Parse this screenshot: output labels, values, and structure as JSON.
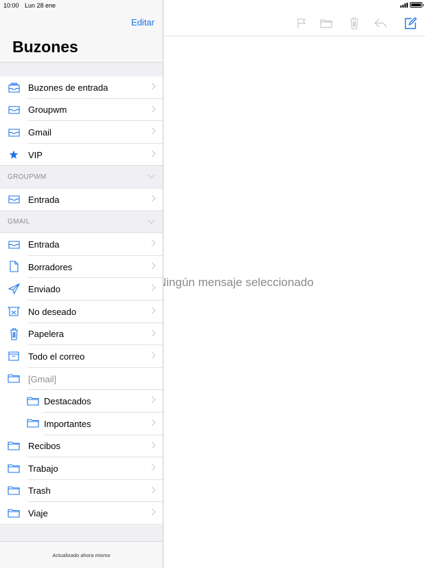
{
  "status_bar": {
    "time": "10:00",
    "date": "Lun 28 ene"
  },
  "sidebar": {
    "edit_label": "Editar",
    "title": "Buzones",
    "rows": [
      {
        "kind": "row",
        "label": "Buzones de entrada",
        "icon": "inbox-stack-icon",
        "chevron": true
      },
      {
        "kind": "row",
        "label": "Groupwm",
        "icon": "inbox-icon",
        "chevron": true
      },
      {
        "kind": "row",
        "label": "Gmail",
        "icon": "inbox-icon",
        "chevron": true
      },
      {
        "kind": "row",
        "label": "VIP",
        "icon": "star-icon",
        "chevron": true,
        "last": true
      },
      {
        "kind": "section",
        "label": "GROUPWM"
      },
      {
        "kind": "row",
        "label": "Entrada",
        "icon": "inbox-icon",
        "chevron": true,
        "last": true
      },
      {
        "kind": "section",
        "label": "GMAIL"
      },
      {
        "kind": "row",
        "label": "Entrada",
        "icon": "inbox-icon",
        "chevron": true
      },
      {
        "kind": "row",
        "label": "Borradores",
        "icon": "document-icon",
        "chevron": true
      },
      {
        "kind": "row",
        "label": "Enviado",
        "icon": "paper-plane-icon",
        "chevron": true
      },
      {
        "kind": "row",
        "label": "No deseado",
        "icon": "junk-icon",
        "chevron": true
      },
      {
        "kind": "row",
        "label": "Papelera",
        "icon": "trash-icon",
        "chevron": true
      },
      {
        "kind": "row",
        "label": "Todo el correo",
        "icon": "archive-icon",
        "chevron": true
      },
      {
        "kind": "row",
        "label": "[Gmail]",
        "icon": "folder-icon",
        "chevron": false,
        "gray": true
      },
      {
        "kind": "row",
        "label": "Destacados",
        "icon": "folder-icon",
        "chevron": true,
        "indent": true
      },
      {
        "kind": "row",
        "label": "Importantes",
        "icon": "folder-icon",
        "chevron": true,
        "indent": true
      },
      {
        "kind": "row",
        "label": "Recibos",
        "icon": "folder-icon",
        "chevron": true
      },
      {
        "kind": "row",
        "label": "Trabajo",
        "icon": "folder-icon",
        "chevron": true
      },
      {
        "kind": "row",
        "label": "Trash",
        "icon": "folder-icon",
        "chevron": true
      },
      {
        "kind": "row",
        "label": "Viaje",
        "icon": "folder-icon",
        "chevron": true,
        "last": true
      }
    ],
    "footer_text": "Actualizado ahora mismo"
  },
  "detail": {
    "empty_message": "Ningún mensaje seleccionado",
    "toolbar": [
      "flag-icon",
      "folder-icon",
      "trash-icon",
      "reply-icon",
      "compose-icon"
    ]
  },
  "colors": {
    "accent": "#1a73e8",
    "disabled": "#c7c7cc"
  }
}
